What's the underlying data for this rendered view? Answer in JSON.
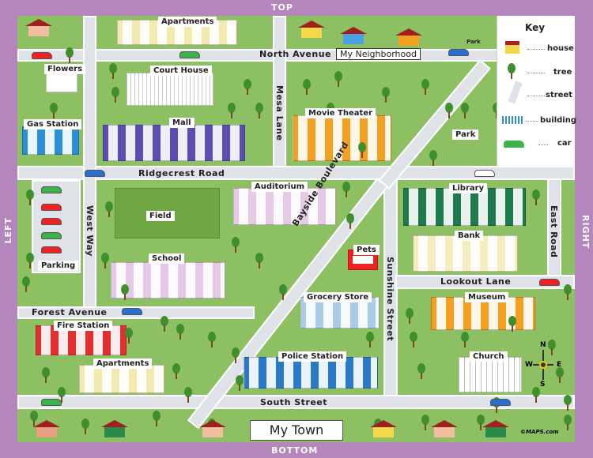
{
  "edges": {
    "top": "TOP",
    "bottom": "BOTTOM",
    "left": "LEFT",
    "right": "RIGHT"
  },
  "title": "My Town",
  "neighborhood": "My Neighborhood",
  "streets": {
    "north": "North Avenue",
    "ridgecrest": "Ridgecrest Road",
    "mesa": "Mesa Lane",
    "west": "West Way",
    "east": "East Road",
    "bayside": "Bayside Boulevard",
    "sunshine": "Sunshine Street",
    "lookout": "Lookout Lane",
    "forest": "Forest Avenue",
    "south": "South Street"
  },
  "places": {
    "apartments_top": "Apartments",
    "flowers": "Flowers",
    "court_house": "Court House",
    "gas_station": "Gas Station",
    "mall": "Mall",
    "movie_theater": "Movie Theater",
    "park": "Park",
    "park_small": "Park",
    "auditorium": "Auditorium",
    "field": "Field",
    "library": "Library",
    "pets": "Pets",
    "bank": "Bank",
    "parking": "Parking",
    "school": "School",
    "grocery": "Grocery Store",
    "museum": "Museum",
    "fire_station": "Fire Station",
    "apartments_bottom": "Apartments",
    "police_station": "Police Station",
    "church": "Church"
  },
  "key": {
    "title": "Key",
    "items": [
      {
        "label": "house",
        "icon": "house-icon"
      },
      {
        "label": "tree",
        "icon": "tree-icon"
      },
      {
        "label": "street",
        "icon": "street-icon"
      },
      {
        "label": "building",
        "icon": "building-icon"
      },
      {
        "label": "car",
        "icon": "car-icon"
      }
    ]
  },
  "compass": {
    "n": "N",
    "e": "E",
    "s": "S",
    "w": "W"
  },
  "copyright": "©MAPS.com",
  "colors": {
    "border": "#b585bd",
    "grass": "#8cc063",
    "road": "#dfe2e7"
  }
}
